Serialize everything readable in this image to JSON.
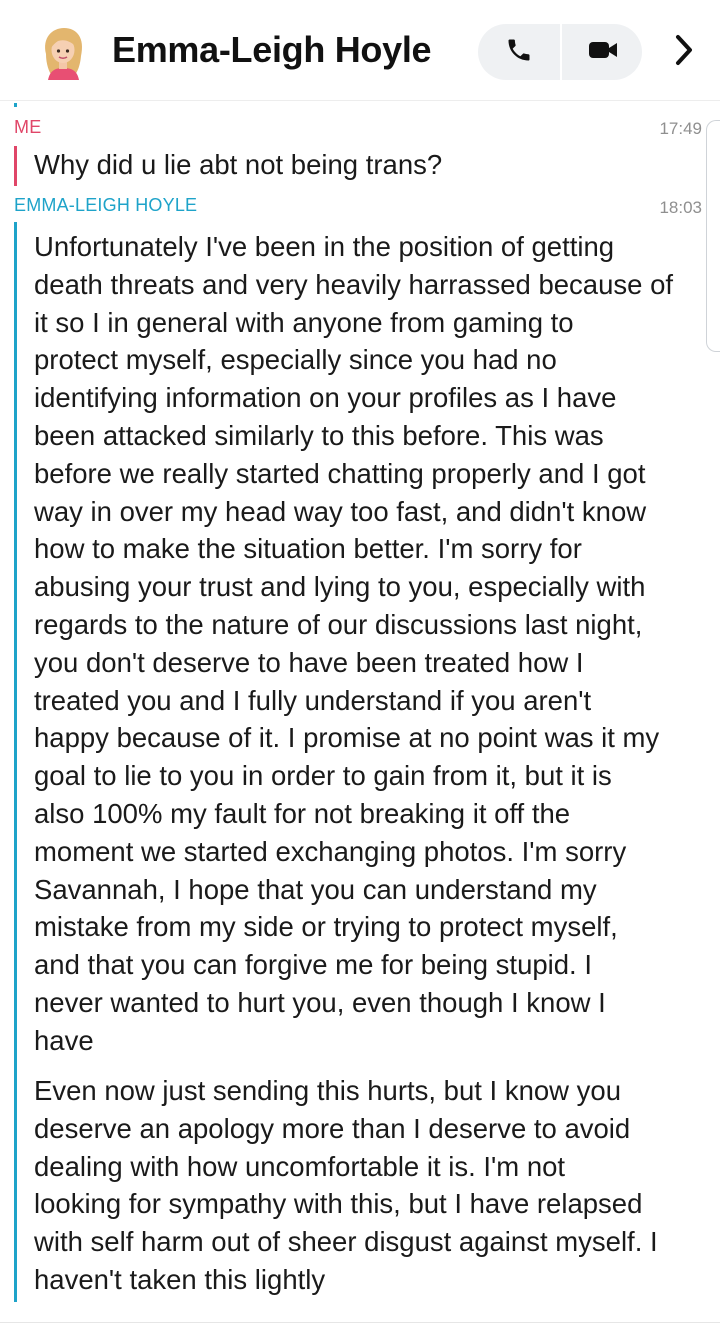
{
  "header": {
    "contact_name": "Emma-Leigh Hoyle",
    "avatar_icon": "bitmoji-avatar-icon",
    "voice_call_icon": "phone-icon",
    "video_call_icon": "video-camera-icon",
    "more_icon": "chevron-right-icon"
  },
  "colors": {
    "me_accent": "#e04668",
    "friend_accent": "#1ea3c9",
    "timestamp": "#8f8f8f",
    "call_button_bg": "#eff1f3"
  },
  "messages": [
    {
      "sender": "ME",
      "time": "17:49",
      "text": "Why did u lie abt not being trans?"
    },
    {
      "sender": "EMMA-LEIGH HOYLE",
      "time": "18:03",
      "text": "Unfortunately I've been in the position of getting\ndeath threats and very heavily harrassed because of\nit so I in general with anyone from gaming to\nprotect myself, especially since you had no\nidentifying information on your profiles as I have\nbeen attacked similarly to this before. This was\nbefore we really started chatting properly and I got\nway in over my head way too fast, and didn't know\nhow to make the situation better. I'm sorry for\nabusing your trust and lying to you, especially with\nregards to the nature of our discussions last night,\nyou don't deserve to have been treated how I\ntreated you and I fully understand if you aren't\nhappy because of it. I promise at no point was it my\ngoal to lie to you in order to gain from it, but it is\nalso 100% my fault for not breaking it off the\nmoment we started exchanging photos. I'm sorry\nSavannah, I hope that you can understand my\nmistake from my side or trying to protect myself,\nand that you can forgive me for being stupid. I\nnever wanted to hurt you, even though I know I\nhave",
      "text_2": "Even now just sending this hurts, but I know you\ndeserve an apology more than I deserve to avoid\ndealing with how uncomfortable it is. I'm not\nlooking for sympathy with this, but I have relapsed\nwith self harm out of sheer disgust against myself. I\nhaven't taken this lightly"
    }
  ]
}
